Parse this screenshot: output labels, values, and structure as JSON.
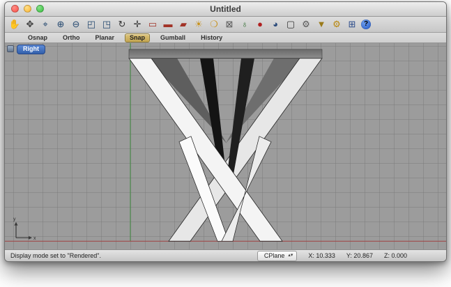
{
  "window": {
    "title": "Untitled"
  },
  "toolbar": {
    "icons": [
      {
        "name": "pan-hand",
        "glyph": "✋",
        "style": "color:#8a6b4a"
      },
      {
        "name": "move",
        "glyph": "✥",
        "style": "color:#3a3a3a"
      },
      {
        "name": "zoom-dynamic",
        "glyph": "⌖",
        "style": "color:#23476e"
      },
      {
        "name": "zoom-in",
        "glyph": "⊕",
        "style": "color:#23476e"
      },
      {
        "name": "zoom-out",
        "glyph": "⊖",
        "style": "color:#23476e"
      },
      {
        "name": "zoom-window",
        "glyph": "◰",
        "style": "color:#23476e"
      },
      {
        "name": "zoom-extents",
        "glyph": "◳",
        "style": "color:#23476e"
      },
      {
        "name": "rotate-view",
        "glyph": "↻",
        "style": "color:#333333"
      },
      {
        "name": "pan-view",
        "glyph": "✛",
        "style": "color:#333333"
      },
      {
        "name": "wireframe-display",
        "glyph": "▭",
        "style": "color:#a23327"
      },
      {
        "name": "shaded-display",
        "glyph": "▬",
        "style": "color:#a23327"
      },
      {
        "name": "rendered-display",
        "glyph": "▰",
        "style": "color:#a23327"
      },
      {
        "name": "lights",
        "glyph": "☀",
        "style": "color:#c8921d"
      },
      {
        "name": "lamp",
        "glyph": "❍",
        "style": "color:#c8921d"
      },
      {
        "name": "lock",
        "glyph": "⊠",
        "style": "color:#555555"
      },
      {
        "name": "earth",
        "glyph": "♁",
        "style": "color:#2f6d2f"
      },
      {
        "name": "render-sphere",
        "glyph": "●",
        "style": "color:#b02020"
      },
      {
        "name": "material-sphere",
        "glyph": "◕",
        "style": "color:#2a4a7a"
      },
      {
        "name": "monitor",
        "glyph": "▢",
        "style": "color:#333333"
      },
      {
        "name": "gear",
        "glyph": "⚙",
        "style": "color:#555555"
      },
      {
        "name": "filter",
        "glyph": "▼",
        "style": "color:#9a7a1a"
      },
      {
        "name": "options-gears",
        "glyph": "⚙",
        "style": "color:#b8860b"
      },
      {
        "name": "gumball-widget",
        "glyph": "⊞",
        "style": "color:#2a4a8a"
      },
      {
        "name": "help",
        "glyph": "?",
        "style": "color:#ffffff"
      }
    ]
  },
  "modebar": {
    "buttons": [
      {
        "label": "Osnap",
        "active": false
      },
      {
        "label": "Ortho",
        "active": false
      },
      {
        "label": "Planar",
        "active": false
      },
      {
        "label": "Snap",
        "active": true
      },
      {
        "label": "Gumball",
        "active": false
      },
      {
        "label": "History",
        "active": false
      }
    ]
  },
  "viewport": {
    "label": "Right",
    "axis_labels": {
      "x": "x",
      "y": "y"
    },
    "colors": {
      "background": "#9c9c9c",
      "grid": "#8f8f8f",
      "x_axis": "#a04040",
      "y_axis": "#3f8a3f",
      "label_blue": "#3360ab",
      "snap_active": "#c3a551"
    }
  },
  "statusbar": {
    "message": "Display mode set to \"Rendered\".",
    "cplane_label": "CPlane",
    "dropdown_arrows": "▴▾",
    "coords": {
      "x": "X: 10.333",
      "y": "Y: 20.867",
      "z": "Z: 0.000"
    }
  }
}
